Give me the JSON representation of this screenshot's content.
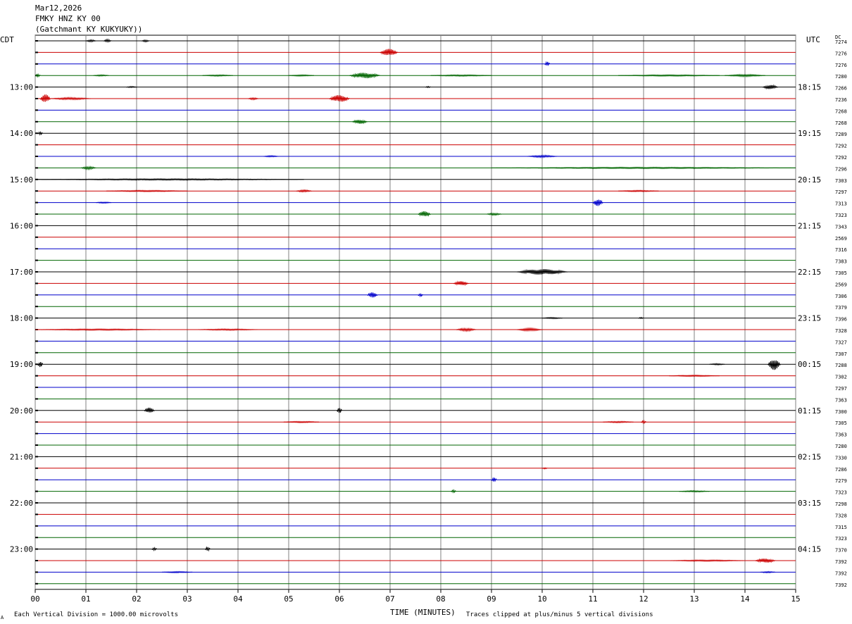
{
  "header": {
    "date": "Mar12,2026",
    "station": "FMKY HNZ KY 00",
    "location": "(Gatchmant KY KUKYUKY))"
  },
  "left_axis_label": "CDT",
  "right_axis_label": "UTC",
  "dc_label": "DC",
  "footer": {
    "scale_note": "Each Vertical Division = 1000.00 microvolts",
    "xlabel": "TIME (MINUTES)",
    "clip_note": "Traces clipped at plus/minus 5 vertical divisions",
    "corner_mark": "A"
  },
  "colors": {
    "black": "#000000",
    "red": "#cc0000",
    "blue": "#0000cc",
    "green": "#006600",
    "grid": "#808080"
  },
  "chart_data": {
    "type": "line",
    "title": "",
    "xlabel": "TIME (MINUTES)",
    "ylabel": "",
    "xlim": [
      0,
      15
    ],
    "x_ticks": [
      "00",
      "01",
      "02",
      "03",
      "04",
      "05",
      "06",
      "07",
      "08",
      "09",
      "10",
      "11",
      "12",
      "13",
      "14",
      "15"
    ],
    "grid": true,
    "trace_minutes": 15,
    "color_cycle": [
      "black",
      "red",
      "blue",
      "green"
    ],
    "left_time_labels": [
      {
        "trace": 4,
        "label": "13:00"
      },
      {
        "trace": 8,
        "label": "14:00"
      },
      {
        "trace": 12,
        "label": "15:00"
      },
      {
        "trace": 16,
        "label": "16:00"
      },
      {
        "trace": 20,
        "label": "17:00"
      },
      {
        "trace": 24,
        "label": "18:00"
      },
      {
        "trace": 28,
        "label": "19:00"
      },
      {
        "trace": 32,
        "label": "20:00"
      },
      {
        "trace": 36,
        "label": "21:00"
      },
      {
        "trace": 40,
        "label": "22:00"
      },
      {
        "trace": 44,
        "label": "23:00"
      }
    ],
    "right_time_labels": [
      {
        "trace": 4,
        "label": "18:15"
      },
      {
        "trace": 8,
        "label": "19:15"
      },
      {
        "trace": 12,
        "label": "20:15"
      },
      {
        "trace": 16,
        "label": "21:15"
      },
      {
        "trace": 20,
        "label": "22:15"
      },
      {
        "trace": 24,
        "label": "23:15"
      },
      {
        "trace": 28,
        "label": "00:15"
      },
      {
        "trace": 32,
        "label": "01:15"
      },
      {
        "trace": 36,
        "label": "02:15"
      },
      {
        "trace": 40,
        "label": "03:15"
      },
      {
        "trace": 44,
        "label": "04:15"
      }
    ],
    "dc_offsets": [
      "7274",
      "7276",
      "7276",
      "7280",
      "7266",
      "7236",
      "7268",
      "7268",
      "7289",
      "7292",
      "7292",
      "7296",
      "7303",
      "7297",
      "7313",
      "7323",
      "7343",
      "2569",
      "7316",
      "7383",
      "7305",
      "2569",
      "7306",
      "7379",
      "7396",
      "7328",
      "7327",
      "7307",
      "7288",
      "7302",
      "7297",
      "7363",
      "7300",
      "7305",
      "7363",
      "7280",
      "7330",
      "7286",
      "7279",
      "7323",
      "7298",
      "7328",
      "7315",
      "7323",
      "7370",
      "7392",
      "7392",
      "7392"
    ],
    "events": [
      {
        "trace": 0,
        "at": 1.0,
        "len": 0.2,
        "amp": 1.5
      },
      {
        "trace": 0,
        "at": 1.35,
        "len": 0.15,
        "amp": 2
      },
      {
        "trace": 0,
        "at": 2.1,
        "len": 0.15,
        "amp": 1.5
      },
      {
        "trace": 1,
        "at": 6.8,
        "len": 0.35,
        "amp": 5
      },
      {
        "trace": 2,
        "at": 10.05,
        "len": 0.1,
        "amp": 3
      },
      {
        "trace": 3,
        "at": 0.0,
        "len": 0.1,
        "amp": 2
      },
      {
        "trace": 3,
        "at": 1.15,
        "len": 0.3,
        "amp": 1
      },
      {
        "trace": 3,
        "at": 3.3,
        "len": 0.6,
        "amp": 1
      },
      {
        "trace": 3,
        "at": 5.0,
        "len": 0.5,
        "amp": 1
      },
      {
        "trace": 3,
        "at": 6.2,
        "len": 0.6,
        "amp": 4
      },
      {
        "trace": 3,
        "at": 7.8,
        "len": 1.2,
        "amp": 1
      },
      {
        "trace": 3,
        "at": 11.5,
        "len": 2.0,
        "amp": 1
      },
      {
        "trace": 3,
        "at": 13.6,
        "len": 0.8,
        "amp": 1.5
      },
      {
        "trace": 4,
        "at": 1.8,
        "len": 0.2,
        "amp": 1
      },
      {
        "trace": 4,
        "at": 7.7,
        "len": 0.1,
        "amp": 1
      },
      {
        "trace": 4,
        "at": 14.35,
        "len": 0.3,
        "amp": 3
      },
      {
        "trace": 5,
        "at": 0.1,
        "len": 0.2,
        "amp": 6
      },
      {
        "trace": 5,
        "at": 0.3,
        "len": 0.8,
        "amp": 1.5
      },
      {
        "trace": 5,
        "at": 4.2,
        "len": 0.2,
        "amp": 1.5
      },
      {
        "trace": 5,
        "at": 5.8,
        "len": 0.4,
        "amp": 5
      },
      {
        "trace": 7,
        "at": 6.25,
        "len": 0.3,
        "amp": 3
      },
      {
        "trace": 8,
        "at": 0.05,
        "len": 0.1,
        "amp": 2
      },
      {
        "trace": 10,
        "at": 4.5,
        "len": 0.3,
        "amp": 1
      },
      {
        "trace": 10,
        "at": 9.7,
        "len": 0.6,
        "amp": 1.5
      },
      {
        "trace": 11,
        "at": 0.9,
        "len": 0.3,
        "amp": 2
      },
      {
        "trace": 11,
        "at": 9.0,
        "len": 6.0,
        "amp": 1
      },
      {
        "trace": 12,
        "at": 0.0,
        "len": 5.3,
        "amp": 1
      },
      {
        "trace": 13,
        "at": 1.4,
        "len": 1.6,
        "amp": 1
      },
      {
        "trace": 13,
        "at": 5.15,
        "len": 0.3,
        "amp": 1.5
      },
      {
        "trace": 13,
        "at": 11.5,
        "len": 0.8,
        "amp": 1
      },
      {
        "trace": 14,
        "at": 1.2,
        "len": 0.3,
        "amp": 1
      },
      {
        "trace": 14,
        "at": 11.0,
        "len": 0.2,
        "amp": 5
      },
      {
        "trace": 15,
        "at": 7.55,
        "len": 0.25,
        "amp": 4
      },
      {
        "trace": 15,
        "at": 8.9,
        "len": 0.3,
        "amp": 1.5
      },
      {
        "trace": 20,
        "at": 9.5,
        "len": 1.0,
        "amp": 4
      },
      {
        "trace": 21,
        "at": 8.25,
        "len": 0.3,
        "amp": 3
      },
      {
        "trace": 22,
        "at": 6.55,
        "len": 0.2,
        "amp": 4
      },
      {
        "trace": 22,
        "at": 7.55,
        "len": 0.1,
        "amp": 2
      },
      {
        "trace": 24,
        "at": 10.0,
        "len": 0.4,
        "amp": 1
      },
      {
        "trace": 24,
        "at": 11.9,
        "len": 0.1,
        "amp": 1
      },
      {
        "trace": 25,
        "at": 0.0,
        "len": 2.5,
        "amp": 1
      },
      {
        "trace": 25,
        "at": 3.2,
        "len": 1.2,
        "amp": 1
      },
      {
        "trace": 25,
        "at": 8.3,
        "len": 0.4,
        "amp": 2
      },
      {
        "trace": 25,
        "at": 9.5,
        "len": 0.5,
        "amp": 2
      },
      {
        "trace": 28,
        "at": 0.05,
        "len": 0.1,
        "amp": 4
      },
      {
        "trace": 28,
        "at": 13.3,
        "len": 0.3,
        "amp": 1
      },
      {
        "trace": 28,
        "at": 14.45,
        "len": 0.25,
        "amp": 8
      },
      {
        "trace": 29,
        "at": 12.5,
        "len": 1.0,
        "amp": 1
      },
      {
        "trace": 32,
        "at": 2.15,
        "len": 0.2,
        "amp": 4
      },
      {
        "trace": 32,
        "at": 5.95,
        "len": 0.1,
        "amp": 4
      },
      {
        "trace": 33,
        "at": 4.9,
        "len": 0.7,
        "amp": 1
      },
      {
        "trace": 33,
        "at": 11.2,
        "len": 0.6,
        "amp": 1
      },
      {
        "trace": 33,
        "at": 11.95,
        "len": 0.1,
        "amp": 2
      },
      {
        "trace": 37,
        "at": 10.0,
        "len": 0.1,
        "amp": 1
      },
      {
        "trace": 38,
        "at": 9.0,
        "len": 0.1,
        "amp": 3
      },
      {
        "trace": 39,
        "at": 8.2,
        "len": 0.1,
        "amp": 2
      },
      {
        "trace": 39,
        "at": 12.7,
        "len": 0.6,
        "amp": 1
      },
      {
        "trace": 44,
        "at": 2.3,
        "len": 0.1,
        "amp": 2
      },
      {
        "trace": 44,
        "at": 3.35,
        "len": 0.1,
        "amp": 3
      },
      {
        "trace": 45,
        "at": 12.5,
        "len": 1.5,
        "amp": 1
      },
      {
        "trace": 45,
        "at": 14.2,
        "len": 0.4,
        "amp": 3
      },
      {
        "trace": 46,
        "at": 2.5,
        "len": 0.6,
        "amp": 1
      },
      {
        "trace": 46,
        "at": 14.3,
        "len": 0.3,
        "amp": 1
      }
    ]
  }
}
